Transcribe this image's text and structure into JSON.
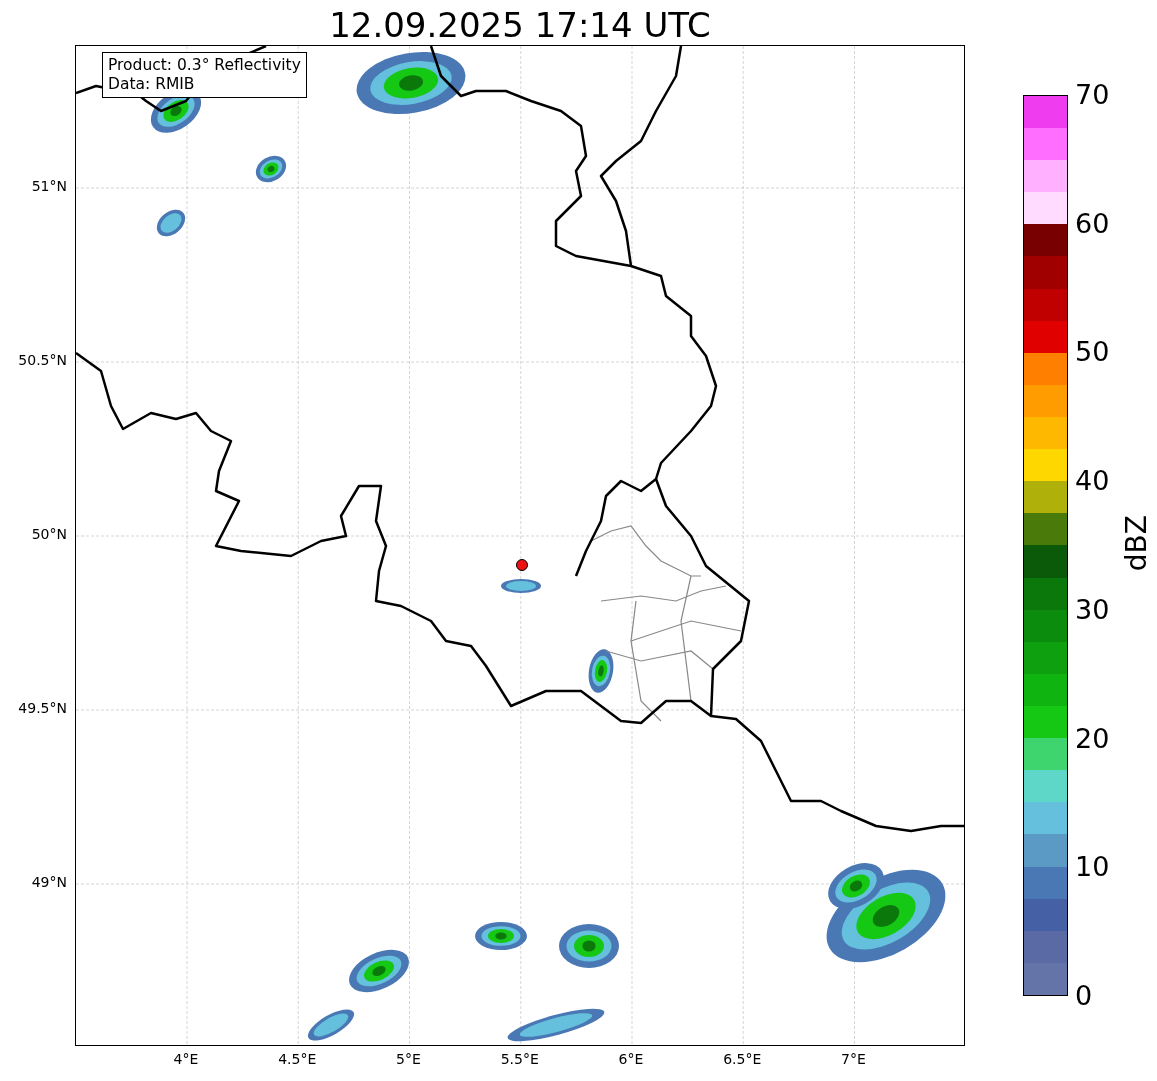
{
  "title": "12.09.2025 17:14 UTC",
  "info_box": [
    "Product: 0.3° Reflectivity",
    "Data: RMIB"
  ],
  "map": {
    "lat_ticks": [
      "51°N",
      "50.5°N",
      "50°N",
      "49.5°N",
      "49°N"
    ],
    "lon_ticks": [
      "4°E",
      "4.5°E",
      "5°E",
      "5.5°E",
      "6°E",
      "6.5°E",
      "7°E"
    ]
  },
  "colorbar": {
    "label": "dBZ",
    "ticks": [
      "70",
      "60",
      "50",
      "40",
      "30",
      "20",
      "10",
      "0"
    ],
    "levels": [
      {
        "color": "#6474a8"
      },
      {
        "color": "#5a6aa5"
      },
      {
        "color": "#4660a6"
      },
      {
        "color": "#4a78b4"
      },
      {
        "color": "#5a9ac5"
      },
      {
        "color": "#64c0dc"
      },
      {
        "color": "#5ed6c8"
      },
      {
        "color": "#3ed46e"
      },
      {
        "color": "#14c814"
      },
      {
        "color": "#10b410"
      },
      {
        "color": "#0ea00e"
      },
      {
        "color": "#0c8c0c"
      },
      {
        "color": "#0a780a"
      },
      {
        "color": "#0a5a0a"
      },
      {
        "color": "#4a7a0a"
      },
      {
        "color": "#b0b00a"
      },
      {
        "color": "#ffd700"
      },
      {
        "color": "#ffb800"
      },
      {
        "color": "#ff9c00"
      },
      {
        "color": "#ff8000"
      },
      {
        "color": "#e00000"
      },
      {
        "color": "#c00000"
      },
      {
        "color": "#a00000"
      },
      {
        "color": "#780000"
      },
      {
        "color": "#ffdcff"
      },
      {
        "color": "#ffb0ff"
      },
      {
        "color": "#ff6eff"
      },
      {
        "color": "#ee3cee"
      }
    ]
  }
}
